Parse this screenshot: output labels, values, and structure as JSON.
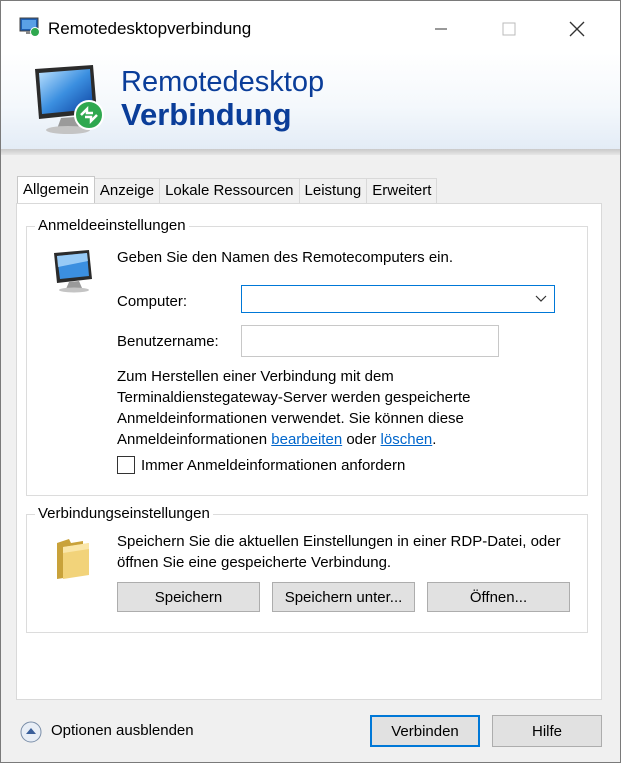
{
  "window": {
    "title": "Remotedesktopverbindung",
    "controls": {
      "minimize": "—",
      "maximize": "☐",
      "close": "✕"
    }
  },
  "banner": {
    "title_line1": "Remotedesktop",
    "title_line2": "Verbindung"
  },
  "tabs": [
    {
      "label": "Allgemein",
      "active": true
    },
    {
      "label": "Anzeige",
      "active": false
    },
    {
      "label": "Lokale Ressourcen",
      "active": false
    },
    {
      "label": "Leistung",
      "active": false
    },
    {
      "label": "Erweitert",
      "active": false
    }
  ],
  "logon_settings": {
    "legend": "Anmeldeeinstellungen",
    "hint": "Geben Sie den Namen des Remotecomputers ein.",
    "computer_label": "Computer:",
    "computer_value": "",
    "username_label": "Benutzername:",
    "username_value": "",
    "info_text": "Zum Herstellen einer Verbindung mit dem Terminaldienstegateway-Server werden gespeicherte Anmeldeinformationen verwendet. Sie können diese Anmeldeinformationen",
    "link_edit": "bearbeiten",
    "connector": "oder",
    "link_delete": "löschen",
    "period": ".",
    "always_ask_label": "Immer Anmeldeinformationen anfordern",
    "always_ask_checked": false
  },
  "connection_settings": {
    "legend": "Verbindungseinstellungen",
    "desc": "Speichern Sie die aktuellen Einstellungen in einer RDP-Datei, oder öffnen Sie eine gespeicherte Verbindung.",
    "save_label": "Speichern",
    "save_as_label": "Speichern unter...",
    "open_label": "Öffnen..."
  },
  "footer": {
    "options_label": "Optionen ausblenden",
    "connect_label": "Verbinden",
    "help_label": "Hilfe"
  },
  "colors": {
    "accent": "#0078d7",
    "banner_text": "#0a3d99",
    "link": "#0066cc"
  }
}
